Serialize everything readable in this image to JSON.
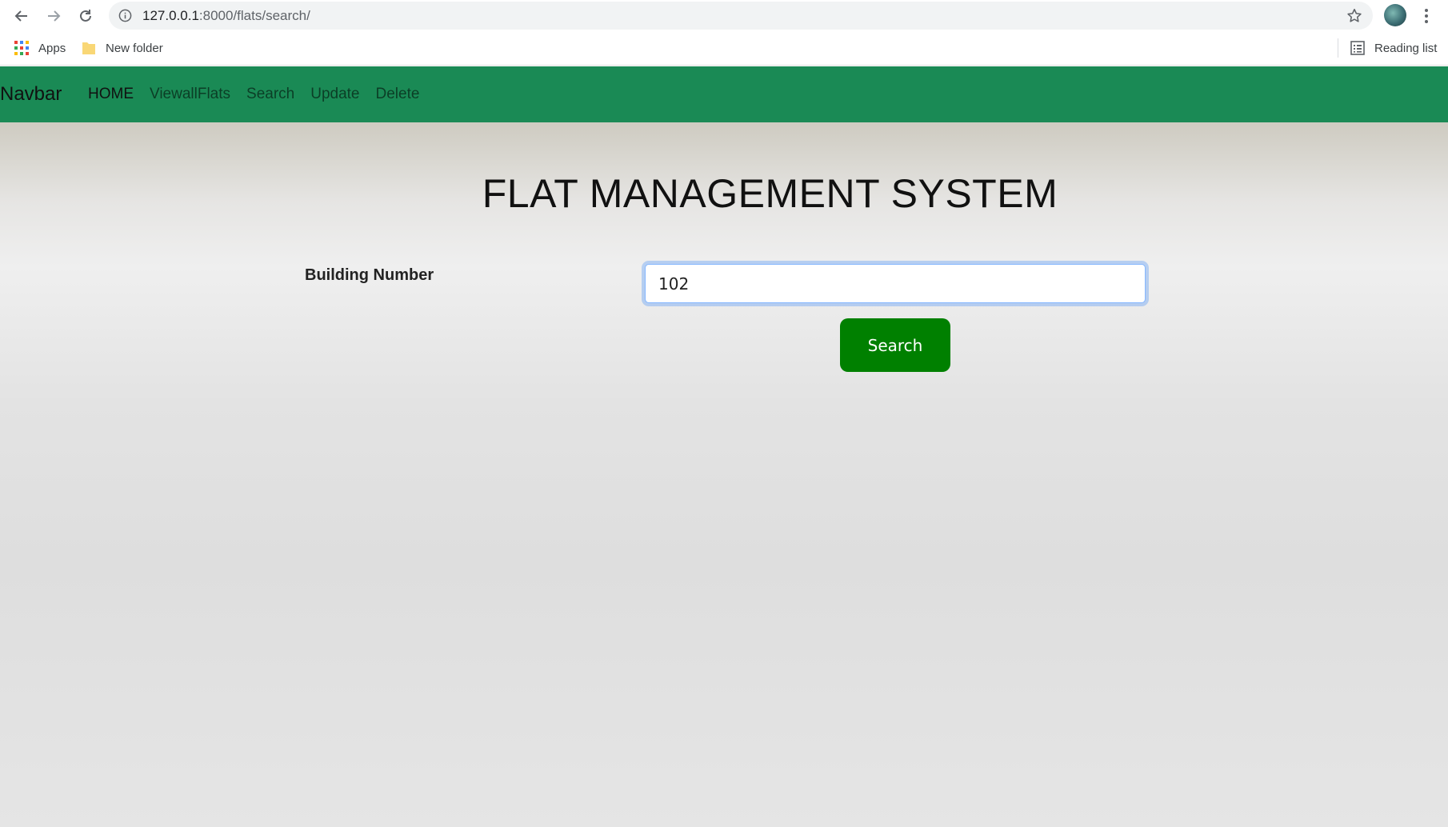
{
  "browser": {
    "url_host": "127.0.0.1",
    "url_path": ":8000/flats/search/",
    "bookmarks": [
      {
        "label": "Apps",
        "icon": "apps-grid-icon"
      },
      {
        "label": "New folder",
        "icon": "folder-icon"
      }
    ],
    "reading_list_label": "Reading list"
  },
  "navbar": {
    "brand": "Navbar",
    "links": [
      {
        "label": "HOME",
        "active": true
      },
      {
        "label": "ViewallFlats",
        "active": false
      },
      {
        "label": "Search",
        "active": false
      },
      {
        "label": "Update",
        "active": false
      },
      {
        "label": "Delete",
        "active": false
      }
    ],
    "background_color": "#1a8a55"
  },
  "main": {
    "title": "FLAT MANAGEMENT SYSTEM",
    "field_label": "Building Number",
    "field_value": "102",
    "search_button_label": "Search",
    "search_button_color": "#008000"
  }
}
